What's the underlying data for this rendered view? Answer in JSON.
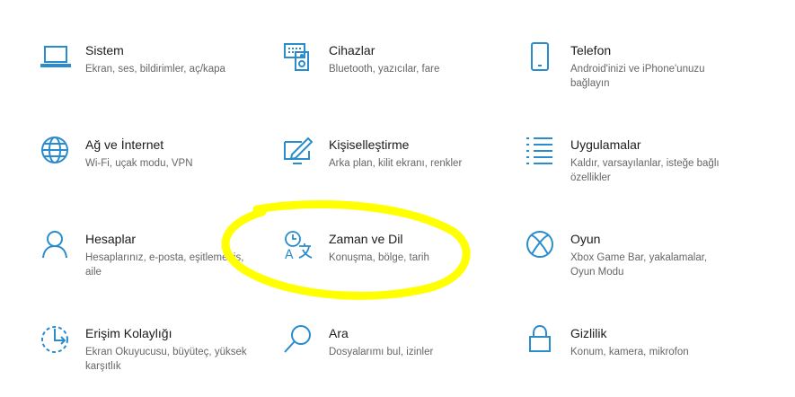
{
  "colors": {
    "icon": "#2a8ccc",
    "highlight": "#ffff00"
  },
  "tiles": [
    {
      "title": "Sistem",
      "desc": "Ekran, ses, bildirimler, aç/kapa",
      "icon": "laptop-icon"
    },
    {
      "title": "Cihazlar",
      "desc": "Bluetooth, yazıcılar, fare",
      "icon": "devices-icon"
    },
    {
      "title": "Telefon",
      "desc": "Android'inizi ve iPhone'unuzu bağlayın",
      "icon": "phone-icon"
    },
    {
      "title": "Ağ ve İnternet",
      "desc": "Wi-Fi, uçak modu, VPN",
      "icon": "globe-icon"
    },
    {
      "title": "Kişiselleştirme",
      "desc": "Arka plan, kilit ekranı, renkler",
      "icon": "personalization-icon"
    },
    {
      "title": "Uygulamalar",
      "desc": "Kaldır, varsayılanlar, isteğe bağlı özellikler",
      "icon": "apps-list-icon"
    },
    {
      "title": "Hesaplar",
      "desc": "Hesaplarınız, e-posta, eşitleme, iş, aile",
      "icon": "person-icon"
    },
    {
      "title": "Zaman ve Dil",
      "desc": "Konuşma, bölge, tarih",
      "icon": "time-language-icon"
    },
    {
      "title": "Oyun",
      "desc": "Xbox Game Bar, yakalamalar, Oyun Modu",
      "icon": "xbox-icon"
    },
    {
      "title": "Erişim Kolaylığı",
      "desc": "Ekran Okuyucusu, büyüteç, yüksek karşıtlık",
      "icon": "ease-of-access-icon"
    },
    {
      "title": "Ara",
      "desc": "Dosyalarımı bul, izinler",
      "icon": "search-icon"
    },
    {
      "title": "Gizlilik",
      "desc": "Konum, kamera, mikrofon",
      "icon": "lock-icon"
    }
  ]
}
